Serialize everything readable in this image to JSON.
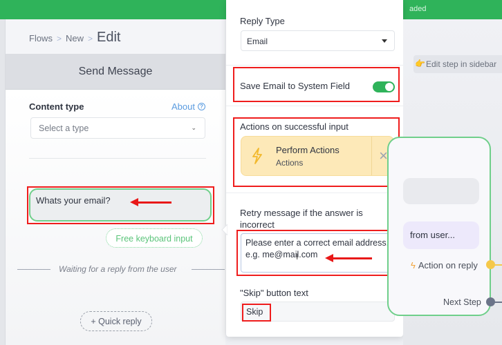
{
  "topbar": {
    "status_text": "aded",
    "color": "#2fb35a"
  },
  "breadcrumb": {
    "items": [
      "Flows",
      "New"
    ],
    "current": "Edit",
    "separator": ">"
  },
  "left_panel": {
    "title": "Send Message",
    "content_type": {
      "label": "Content type",
      "about_label": "About",
      "help_icon": "?",
      "select_placeholder": "Select a type",
      "chevron": "⌄"
    },
    "message_text": "Whats your email?",
    "keyboard_chip": "Free keyboard input",
    "waiting_text": "Waiting for a reply from the user",
    "quick_reply": "+ Quick reply"
  },
  "popup": {
    "reply_type": {
      "label": "Reply Type",
      "value": "Email"
    },
    "save_email": {
      "label": "Save Email to System Field",
      "enabled": true
    },
    "actions": {
      "label": "Actions on successful input",
      "card": {
        "title": "Perform Actions",
        "subtitle": "Actions",
        "remove_icon": "×"
      }
    },
    "retry": {
      "label": "Retry message if the answer is incorrect",
      "value": "Please enter a correct email address, e.g. me@mail.com",
      "cursor": "I"
    },
    "skip": {
      "label": "\"Skip\" button text",
      "value": "Skip"
    }
  },
  "canvas": {
    "edit_hint": "Edit step in sidebar",
    "hint_icon": "👉",
    "node": {
      "purple_message": "from user...",
      "action_on_reply": "Action on reply",
      "bolt_icon": "ϟ",
      "next_step": "Next Step"
    },
    "port_colors": {
      "action": "#f5c84a",
      "next": "#6b7489"
    }
  },
  "annotation_colors": {
    "highlight_box": "#ef1c1c",
    "arrow": "#e81818"
  }
}
